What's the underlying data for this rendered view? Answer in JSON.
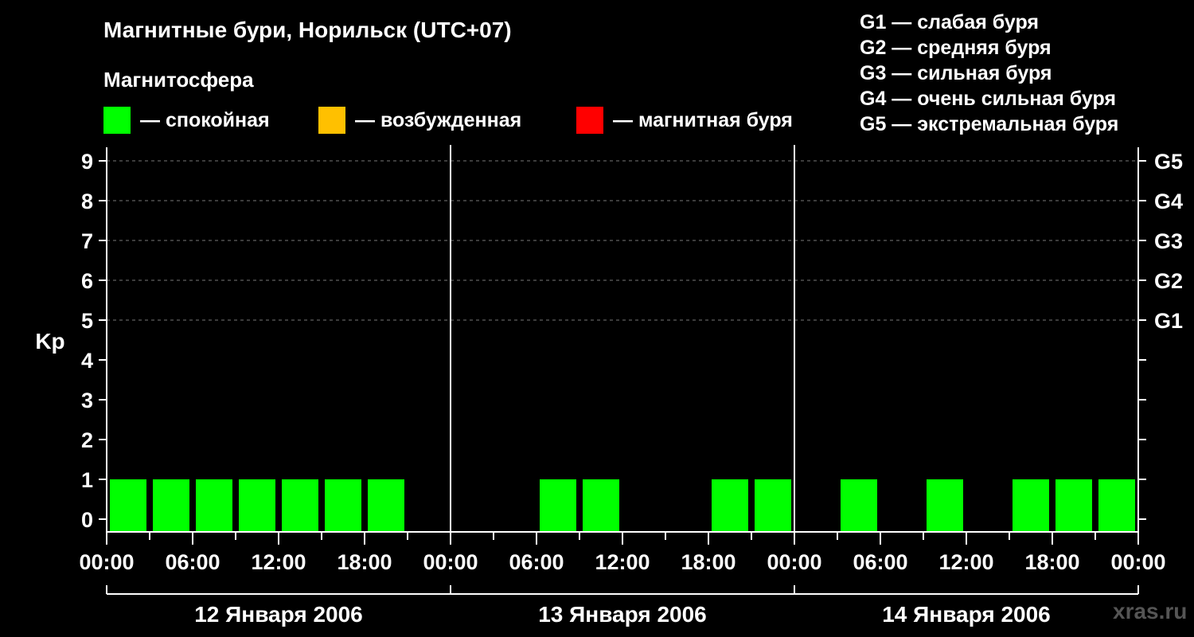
{
  "chart_data": {
    "type": "bar",
    "title": "Магнитные бури, Норильск (UTC+07)",
    "ylabel": "Kp",
    "ylim": [
      0,
      9
    ],
    "yticks": [
      "0",
      "1",
      "2",
      "3",
      "4",
      "5",
      "6",
      "7",
      "8",
      "9"
    ],
    "storm_levels": [
      {
        "kp": 5,
        "label": "G1"
      },
      {
        "kp": 6,
        "label": "G2"
      },
      {
        "kp": 7,
        "label": "G3"
      },
      {
        "kp": 8,
        "label": "G4"
      },
      {
        "kp": 9,
        "label": "G5"
      }
    ],
    "x_tick_labels": [
      "00:00",
      "06:00",
      "12:00",
      "18:00",
      "00:00",
      "06:00",
      "12:00",
      "18:00",
      "00:00",
      "06:00",
      "12:00",
      "18:00",
      "00:00"
    ],
    "days": [
      "12 Января 2006",
      "13 Января 2006",
      "14 Января 2006"
    ],
    "hours_per_bar": 3,
    "bars": [
      {
        "start_hour": 0,
        "value": 1,
        "status": "quiet"
      },
      {
        "start_hour": 3,
        "value": 1,
        "status": "quiet"
      },
      {
        "start_hour": 6,
        "value": 1,
        "status": "quiet"
      },
      {
        "start_hour": 9,
        "value": 1,
        "status": "quiet"
      },
      {
        "start_hour": 12,
        "value": 1,
        "status": "quiet"
      },
      {
        "start_hour": 15,
        "value": 1,
        "status": "quiet"
      },
      {
        "start_hour": 18,
        "value": 1,
        "status": "quiet"
      },
      {
        "start_hour": 21,
        "value": 0,
        "status": "quiet"
      },
      {
        "start_hour": 24,
        "value": 0,
        "status": "quiet"
      },
      {
        "start_hour": 27,
        "value": 0,
        "status": "quiet"
      },
      {
        "start_hour": 30,
        "value": 1,
        "status": "quiet"
      },
      {
        "start_hour": 33,
        "value": 1,
        "status": "quiet"
      },
      {
        "start_hour": 36,
        "value": 0,
        "status": "quiet"
      },
      {
        "start_hour": 39,
        "value": 0,
        "status": "quiet"
      },
      {
        "start_hour": 42,
        "value": 1,
        "status": "quiet"
      },
      {
        "start_hour": 45,
        "value": 1,
        "status": "quiet"
      },
      {
        "start_hour": 48,
        "value": 0,
        "status": "quiet"
      },
      {
        "start_hour": 51,
        "value": 1,
        "status": "quiet"
      },
      {
        "start_hour": 54,
        "value": 0,
        "status": "quiet"
      },
      {
        "start_hour": 57,
        "value": 1,
        "status": "quiet"
      },
      {
        "start_hour": 60,
        "value": 0,
        "status": "quiet"
      },
      {
        "start_hour": 63,
        "value": 1,
        "status": "quiet"
      },
      {
        "start_hour": 66,
        "value": 1,
        "status": "quiet"
      },
      {
        "start_hour": 69,
        "value": 1,
        "status": "quiet"
      }
    ],
    "colors": {
      "quiet": "#00ff00",
      "active": "#ffc000",
      "storm": "#ff0000"
    },
    "grid": true
  },
  "legend": {
    "heading": "Магнитосфера",
    "items": [
      {
        "label": "— спокойная",
        "color": "#00ff00"
      },
      {
        "label": "— возбужденная",
        "color": "#ffc000"
      },
      {
        "label": "— магнитная буря",
        "color": "#ff0000"
      }
    ]
  },
  "storm_scale": [
    "G1 — слабая буря",
    "G2 — средняя буря",
    "G3 — сильная буря",
    "G4 — очень сильная буря",
    "G5 — экстремальная буря"
  ],
  "watermark": "xras.ru"
}
